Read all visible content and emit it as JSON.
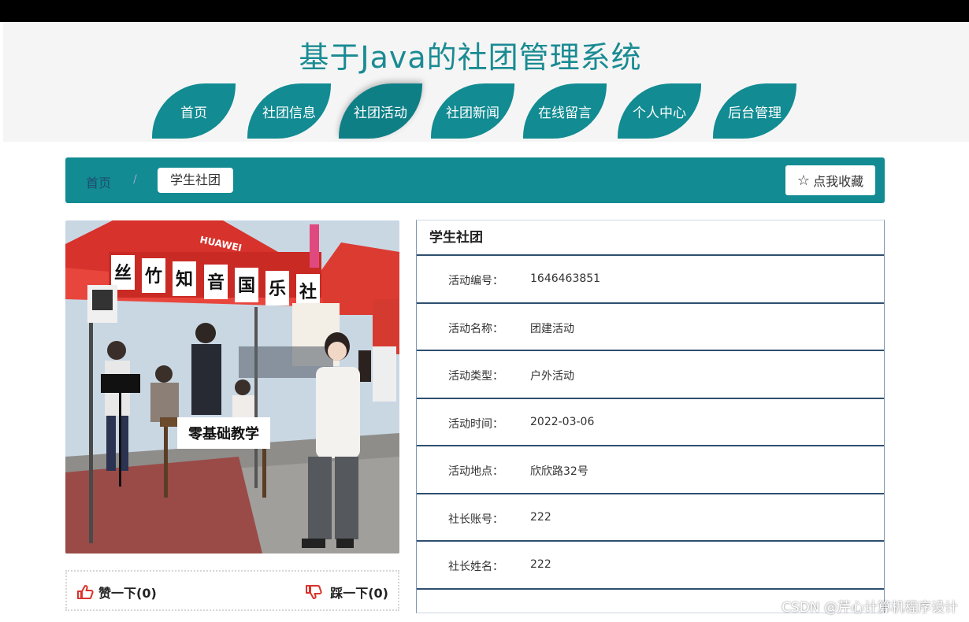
{
  "header": {
    "title": "基于Java的社团管理系统"
  },
  "nav": {
    "items": [
      {
        "label": "首页"
      },
      {
        "label": "社团信息"
      },
      {
        "label": "社团活动"
      },
      {
        "label": "社团新闻"
      },
      {
        "label": "在线留言"
      },
      {
        "label": "个人中心"
      },
      {
        "label": "后台管理"
      }
    ],
    "active_index": 2
  },
  "breadcrumb": {
    "home": "首页",
    "separator": "/",
    "current": "学生社团"
  },
  "favorite_button": {
    "label": "点我收藏",
    "icon": "star-outline-icon"
  },
  "photo": {
    "banner_chars": [
      "丝",
      "竹",
      "知",
      "音",
      "国",
      "乐",
      "社"
    ],
    "table_sign": "零基础教学",
    "tent_brand": "HUAWEI"
  },
  "votes": {
    "like_label": "赞一下(0)",
    "dislike_label": "踩一下(0)"
  },
  "details": {
    "title": "学生社团",
    "rows": [
      {
        "label": "活动编号：",
        "value": "1646463851"
      },
      {
        "label": "活动名称：",
        "value": "团建活动"
      },
      {
        "label": "活动类型：",
        "value": "户外活动"
      },
      {
        "label": "活动时间：",
        "value": "2022-03-06"
      },
      {
        "label": "活动地点：",
        "value": "欣欣路32号"
      },
      {
        "label": "社长账号：",
        "value": "222"
      },
      {
        "label": "社长姓名：",
        "value": "222"
      }
    ]
  },
  "watermark": "CSDN @芹心计算机程序设计",
  "colors": {
    "primary": "#128b92",
    "title": "#1a8b93"
  }
}
